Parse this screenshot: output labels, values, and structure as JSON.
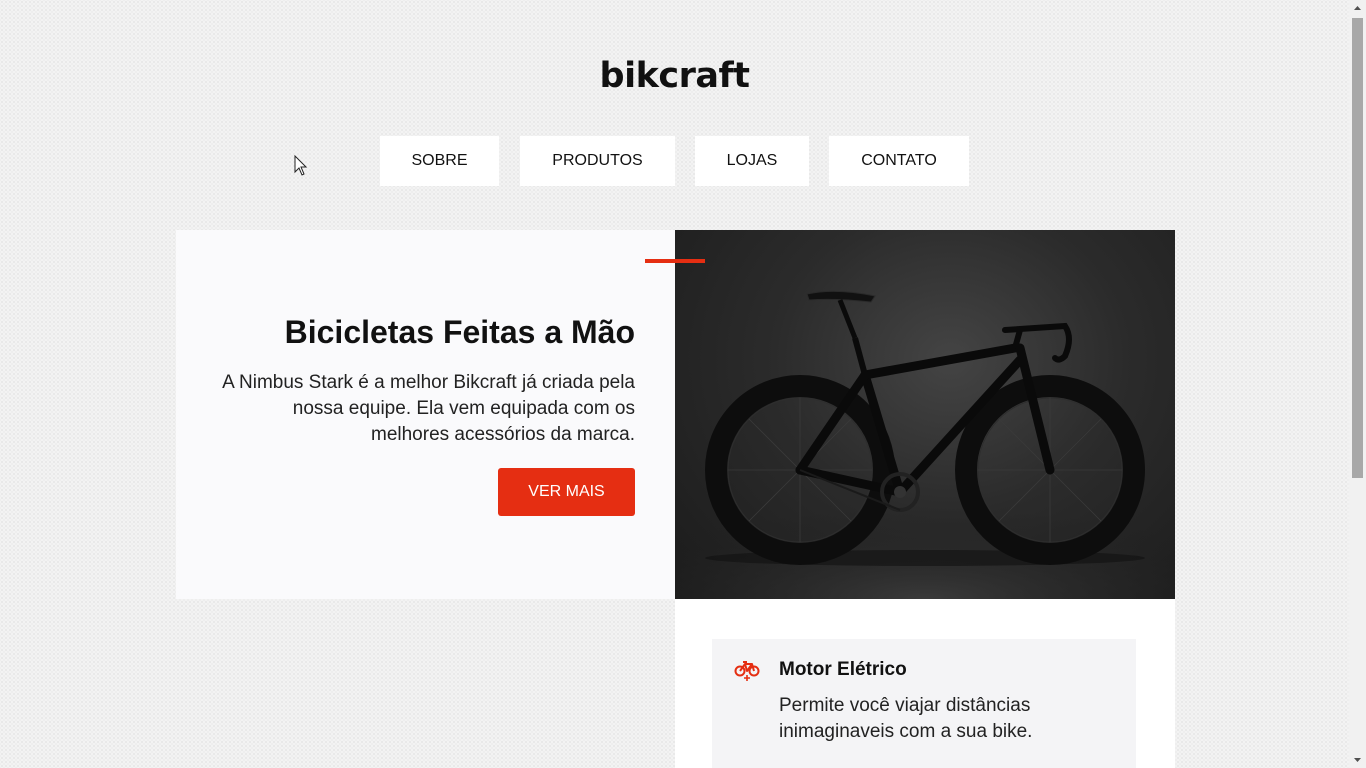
{
  "logo": "bikcraft",
  "nav": [
    {
      "label": "SOBRE"
    },
    {
      "label": "PRODUTOS"
    },
    {
      "label": "LOJAS"
    },
    {
      "label": "CONTATO"
    }
  ],
  "hero": {
    "title": "Bicicletas Feitas a Mão",
    "text": "A Nimbus Stark é a melhor Bikcraft já criada pela nossa equipe. Ela vem equipada com os melhores acessórios da marca.",
    "button": "VER MAIS"
  },
  "features": [
    {
      "icon": "electric-bike-icon",
      "title": "Motor Elétrico",
      "text": "Permite você viajar distâncias inimaginaveis com a sua bike."
    }
  ],
  "colors": {
    "accent": "#e52e12",
    "text": "#111111",
    "card": "#fafafc"
  }
}
